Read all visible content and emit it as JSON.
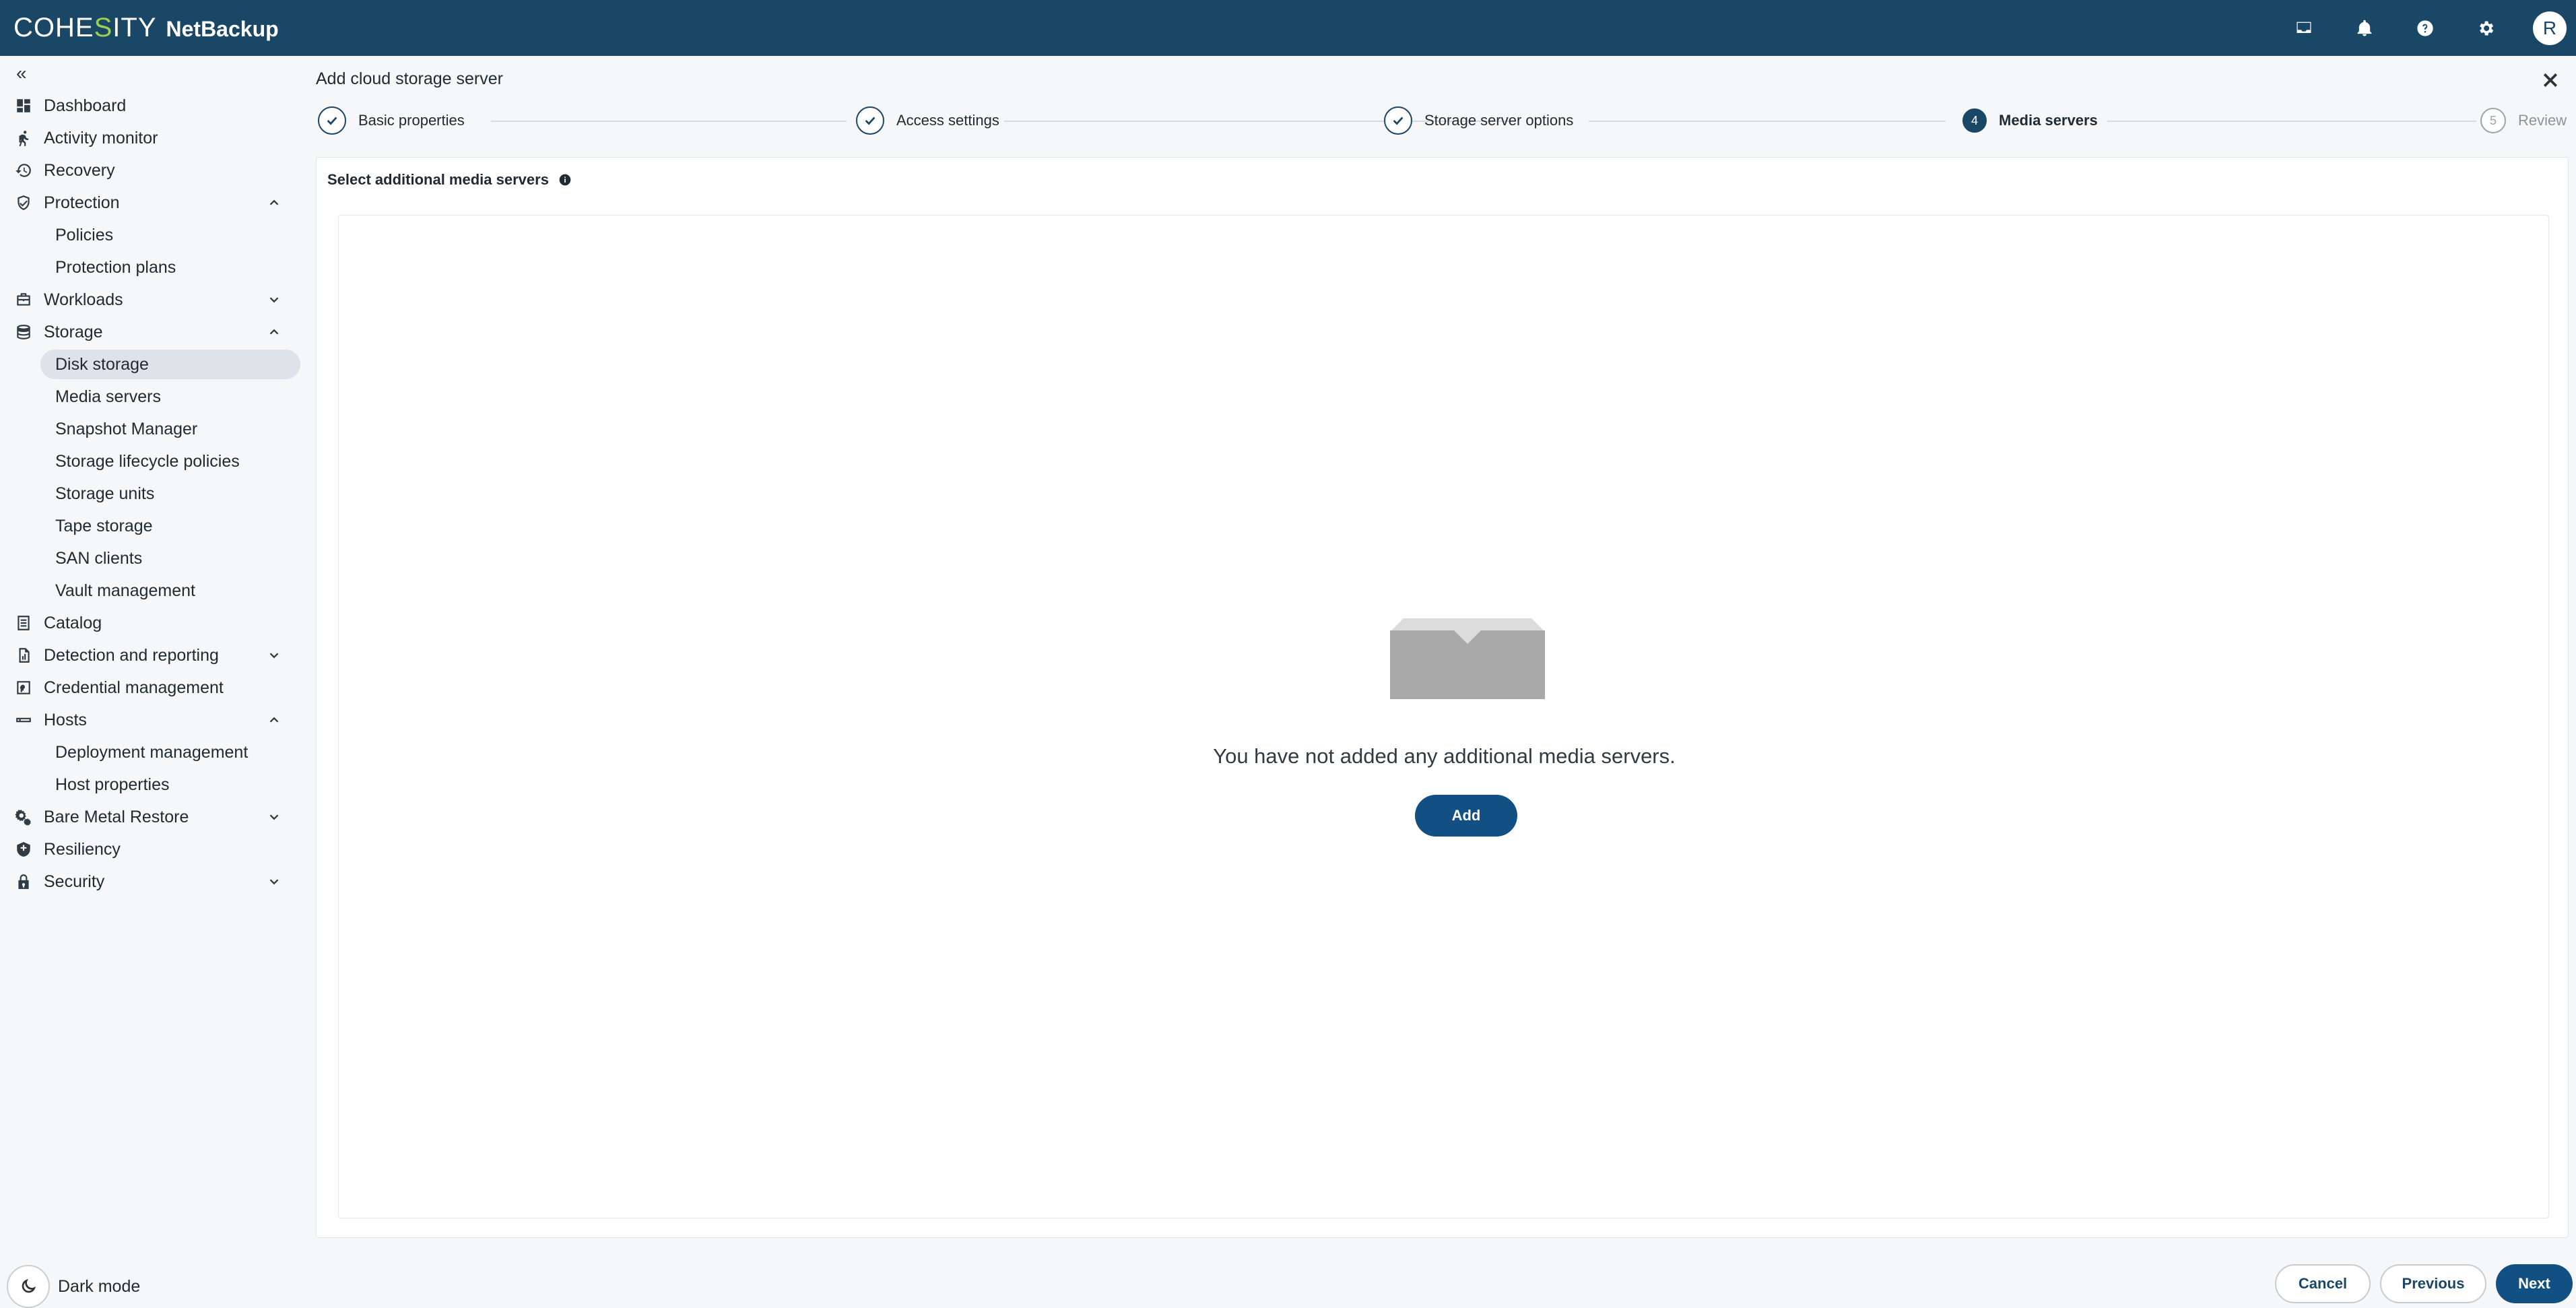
{
  "brand": {
    "logo_left": "COHE",
    "logo_accent": "S",
    "logo_right": "ITY",
    "product": "NetBackup"
  },
  "topbar": {
    "avatar_initial": "R"
  },
  "sidebar": {
    "collapse_label": "«",
    "items": [
      {
        "label": "Dashboard"
      },
      {
        "label": "Activity monitor"
      },
      {
        "label": "Recovery"
      },
      {
        "label": "Protection"
      },
      {
        "label": "Policies"
      },
      {
        "label": "Protection plans"
      },
      {
        "label": "Workloads"
      },
      {
        "label": "Storage"
      },
      {
        "label": "Disk storage"
      },
      {
        "label": "Media servers"
      },
      {
        "label": "Snapshot Manager"
      },
      {
        "label": "Storage lifecycle policies"
      },
      {
        "label": "Storage units"
      },
      {
        "label": "Tape storage"
      },
      {
        "label": "SAN clients"
      },
      {
        "label": "Vault management"
      },
      {
        "label": "Catalog"
      },
      {
        "label": "Detection and reporting"
      },
      {
        "label": "Credential management"
      },
      {
        "label": "Hosts"
      },
      {
        "label": "Deployment management"
      },
      {
        "label": "Host properties"
      },
      {
        "label": "Bare Metal Restore"
      },
      {
        "label": "Resiliency"
      },
      {
        "label": "Security"
      }
    ],
    "dark_mode_label": "Dark mode"
  },
  "wizard": {
    "title": "Add cloud storage server",
    "steps": [
      {
        "label": "Basic properties",
        "state": "done"
      },
      {
        "label": "Access settings",
        "state": "done"
      },
      {
        "label": "Storage server options",
        "state": "done"
      },
      {
        "number": "4",
        "label": "Media servers",
        "state": "current"
      },
      {
        "number": "5",
        "label": "Review",
        "state": "pending"
      }
    ],
    "section_title": "Select additional media servers",
    "empty_message": "You have not added any additional media servers.",
    "add_label": "Add"
  },
  "footer": {
    "cancel_label": "Cancel",
    "previous_label": "Previous",
    "next_label": "Next"
  },
  "colors": {
    "header": "#1b4766",
    "primary": "#124f82",
    "accent": "#9bd14b"
  }
}
